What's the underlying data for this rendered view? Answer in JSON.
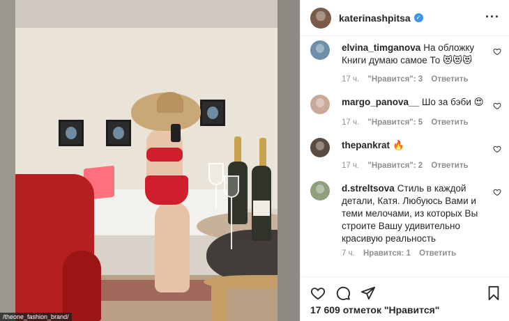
{
  "photo": {
    "watermark": "/theone_fashion_brand/"
  },
  "header": {
    "username": "katerinashpitsa",
    "verified": true,
    "avatar_color": "#7a5a48",
    "more_icon": "more-horizontal-icon"
  },
  "comments": [
    {
      "username": "elvina_timganova",
      "text": "На обложку Книги думаю самое То 😻😻😻",
      "time": "17 ч.",
      "likes": "\"Нравится\": 3",
      "reply": "Ответить",
      "avatar_color": "#6d8fa9"
    },
    {
      "username": "margo_panova__",
      "text": "Шо за бэби 😍",
      "time": "17 ч.",
      "likes": "\"Нравится\": 5",
      "reply": "Ответить",
      "avatar_color": "#c9a99a"
    },
    {
      "username": "thepankrat",
      "text": "🔥",
      "time": "17 ч.",
      "likes": "\"Нравится\": 2",
      "reply": "Ответить",
      "avatar_color": "#5b4a3f"
    },
    {
      "username": "d.streltsova",
      "text": "Стиль в каждой детали, Катя. Любуюсь Вами и теми мелочами, из которых Вы строите Вашу удивительно красивую реальность",
      "time": "7 ч.",
      "likes": "Нравится: 1",
      "reply": "Ответить",
      "avatar_color": "#8fa07e"
    }
  ],
  "actions": {
    "like_icon": "heart-icon",
    "comment_icon": "comment-icon",
    "share_icon": "send-icon",
    "save_icon": "bookmark-icon",
    "likes_text": "17 609 отметок \"Нравится\""
  },
  "colors": {
    "text": "#262626",
    "secondary": "#8e8e8e",
    "verified": "#3897f0",
    "divider": "#efefef"
  }
}
